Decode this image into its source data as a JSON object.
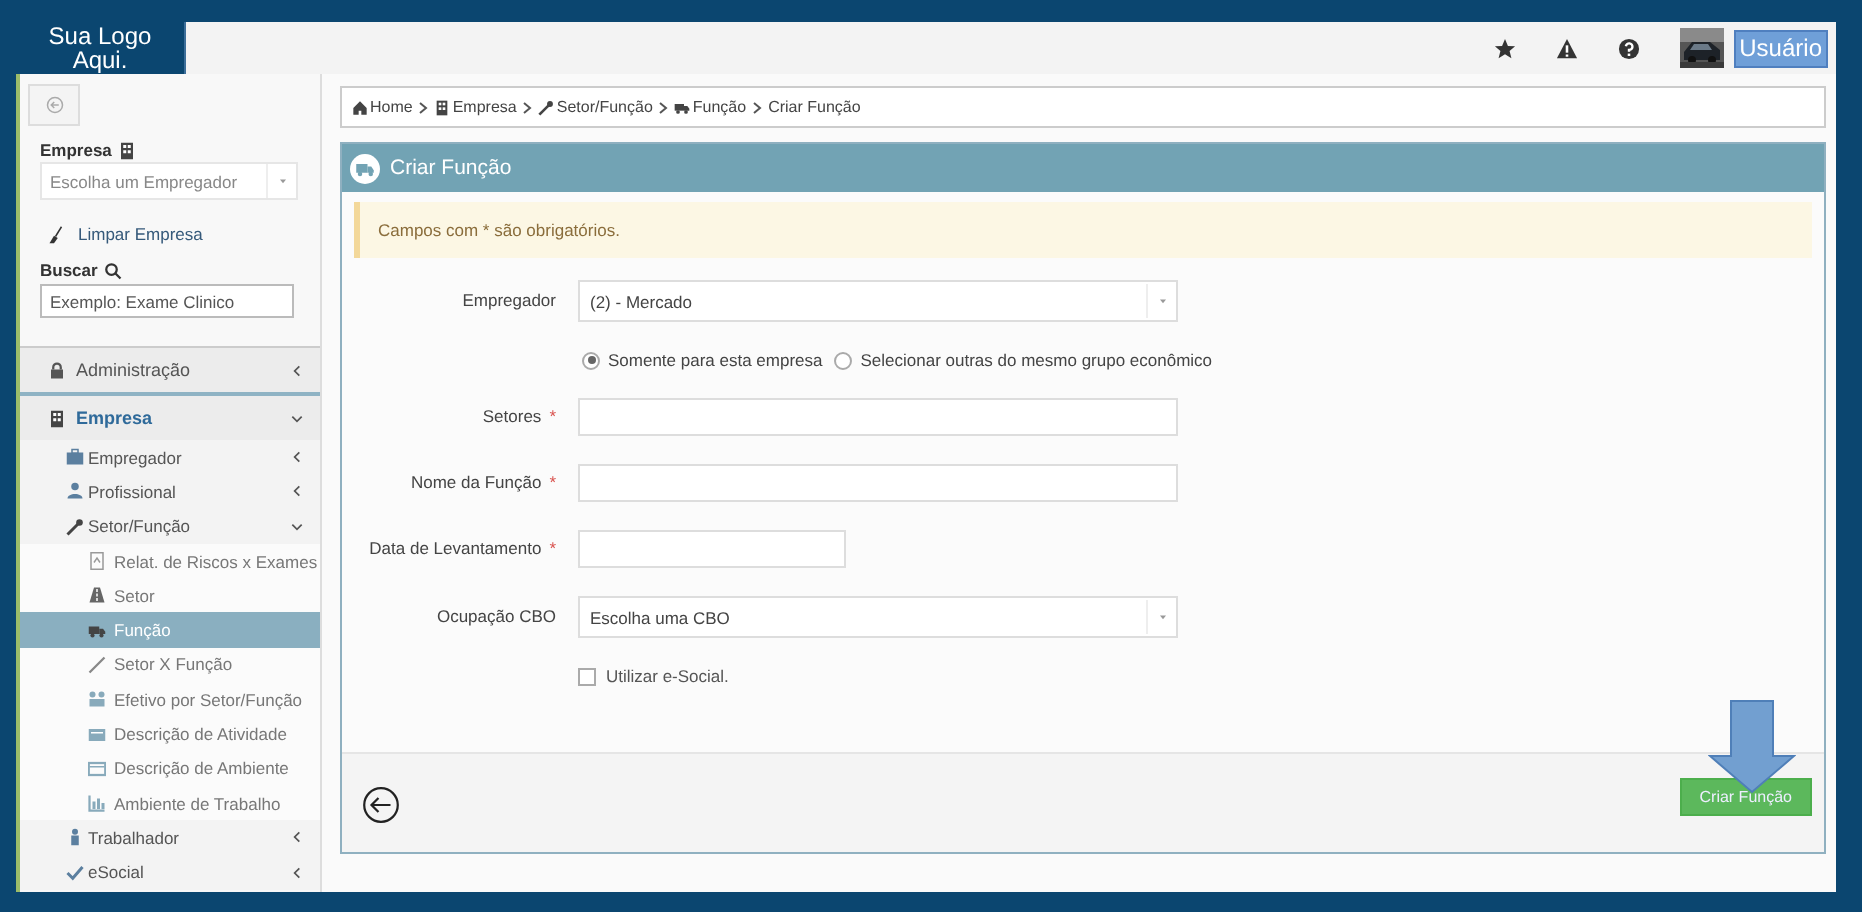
{
  "logo": {
    "text": "Sua Logo Aqui."
  },
  "topbar": {
    "user_button": "Usuário"
  },
  "sidebar": {
    "company_label": "Empresa",
    "company_select": {
      "placeholder": "Escolha um Empregador"
    },
    "clear_link": "Limpar Empresa",
    "search_label": "Buscar",
    "search": {
      "placeholder": "Exemplo: Exame Clinico"
    },
    "menu": [
      {
        "label": "Administração",
        "expanded": false,
        "selected": false
      },
      {
        "label": "Empresa",
        "expanded": true,
        "selected": false,
        "children": [
          {
            "label": "Empregador",
            "expanded": false,
            "selected": false
          },
          {
            "label": "Profissional",
            "expanded": false,
            "selected": false
          },
          {
            "label": "Setor/Função",
            "expanded": true,
            "selected": false,
            "children": [
              {
                "label": "Relat. de Riscos x Exames",
                "selected": false
              },
              {
                "label": "Setor",
                "selected": false
              },
              {
                "label": "Função",
                "selected": true
              },
              {
                "label": "Setor X Função",
                "selected": false
              },
              {
                "label": "Efetivo por Setor/Função",
                "selected": false
              },
              {
                "label": "Descrição de Atividade",
                "selected": false
              },
              {
                "label": "Descrição de Ambiente",
                "selected": false
              },
              {
                "label": "Ambiente de Trabalho",
                "selected": false
              }
            ]
          },
          {
            "label": "Trabalhador",
            "expanded": false,
            "selected": false
          },
          {
            "label": "eSocial",
            "expanded": false,
            "selected": false
          }
        ]
      }
    ]
  },
  "breadcrumb": [
    {
      "label": "Home"
    },
    {
      "label": "Empresa"
    },
    {
      "label": "Setor/Função"
    },
    {
      "label": "Função"
    },
    {
      "label": "Criar Função"
    }
  ],
  "panel": {
    "title": "Criar Função",
    "alert": "Campos com * são obrigatórios.",
    "fields": [
      {
        "kind": "select",
        "label": "Empregador",
        "value": "(2) - Mercado"
      },
      {
        "kind": "radio",
        "options": [
          {
            "label": "Somente para esta empresa",
            "selected": true
          },
          {
            "label": "Selecionar outras do mesmo grupo econômico",
            "selected": false
          }
        ]
      },
      {
        "kind": "text",
        "label": "Setores",
        "required_mark": "*"
      },
      {
        "kind": "text",
        "label": "Nome da Função",
        "required_mark": "*"
      },
      {
        "kind": "date",
        "label": "Data de Levantamento",
        "required_mark": "*"
      },
      {
        "kind": "select",
        "label": "Ocupação CBO",
        "placeholder": "Escolha uma CBO"
      },
      {
        "kind": "checkbox",
        "label": "Utilizar e-Social.",
        "checked": false
      }
    ],
    "submit_button": "Criar Função"
  }
}
